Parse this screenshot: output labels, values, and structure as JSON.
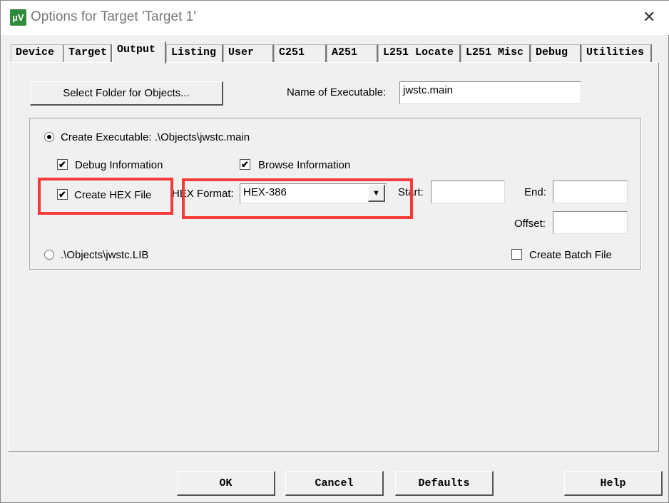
{
  "window": {
    "title": "Options for Target 'Target 1'",
    "icon_label": "µV"
  },
  "tabs": [
    "Device",
    "Target",
    "Output",
    "Listing",
    "User",
    "C251",
    "A251",
    "L251 Locate",
    "L251 Misc",
    "Debug",
    "Utilities"
  ],
  "active_tab": "Output",
  "select_folder_label": "Select Folder for Objects...",
  "name_exec_label": "Name of Executable:",
  "name_exec_value": "jwstc.main",
  "create_exec_label": "Create Executable:  .\\Objects\\jwstc.main",
  "debug_info_label": "Debug Information",
  "browse_info_label": "Browse Information",
  "create_hex_label": "Create HEX File",
  "hex_format_label": "HEX Format:",
  "hex_format_value": "HEX-386",
  "start_label": "Start:",
  "end_label": "End:",
  "offset_label": "Offset:",
  "lib_label": ".\\Objects\\jwstc.LIB",
  "batch_label": "Create Batch File",
  "buttons": {
    "ok": "OK",
    "cancel": "Cancel",
    "defaults": "Defaults",
    "help": "Help"
  },
  "highlight_color": "#f63a3a"
}
